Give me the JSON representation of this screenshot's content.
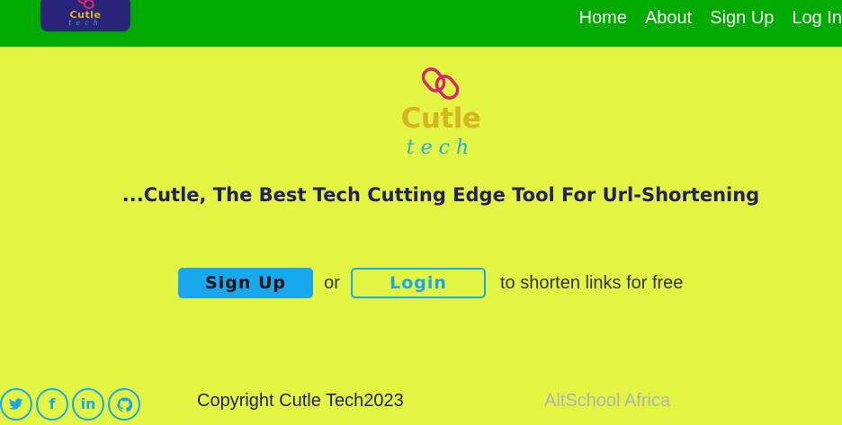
{
  "header": {
    "logo": {
      "word": "Cutle",
      "sub": "tech"
    },
    "nav": [
      {
        "label": "Home"
      },
      {
        "label": "About"
      },
      {
        "label": "Sign Up"
      },
      {
        "label": "Log In"
      }
    ]
  },
  "hero": {
    "logo": {
      "word": "Cutle",
      "sub": "tech"
    },
    "tagline": "...Cutle, The Best Tech Cutting Edge Tool For Url-Shortening",
    "signup_label": "Sign Up",
    "or_text": "or",
    "login_label": "Login",
    "suffix_text": "to shorten links for free"
  },
  "footer": {
    "socials": [
      {
        "icon": "twitter-icon",
        "glyph": "🐦"
      },
      {
        "icon": "facebook-icon",
        "glyph": "f"
      },
      {
        "icon": "linkedin-icon",
        "glyph": "in"
      },
      {
        "icon": "github-icon",
        "glyph": "◉"
      }
    ],
    "copyright": "Copyright Cutle Tech2023",
    "link": "AltSchool Africa"
  },
  "colors": {
    "background": "#e2f542",
    "topbar": "#00aa00",
    "accent": "#1aa7ec",
    "text_dark": "#26215e",
    "logo_gold": "#d6b524",
    "logo_pink": "#d6246e"
  }
}
